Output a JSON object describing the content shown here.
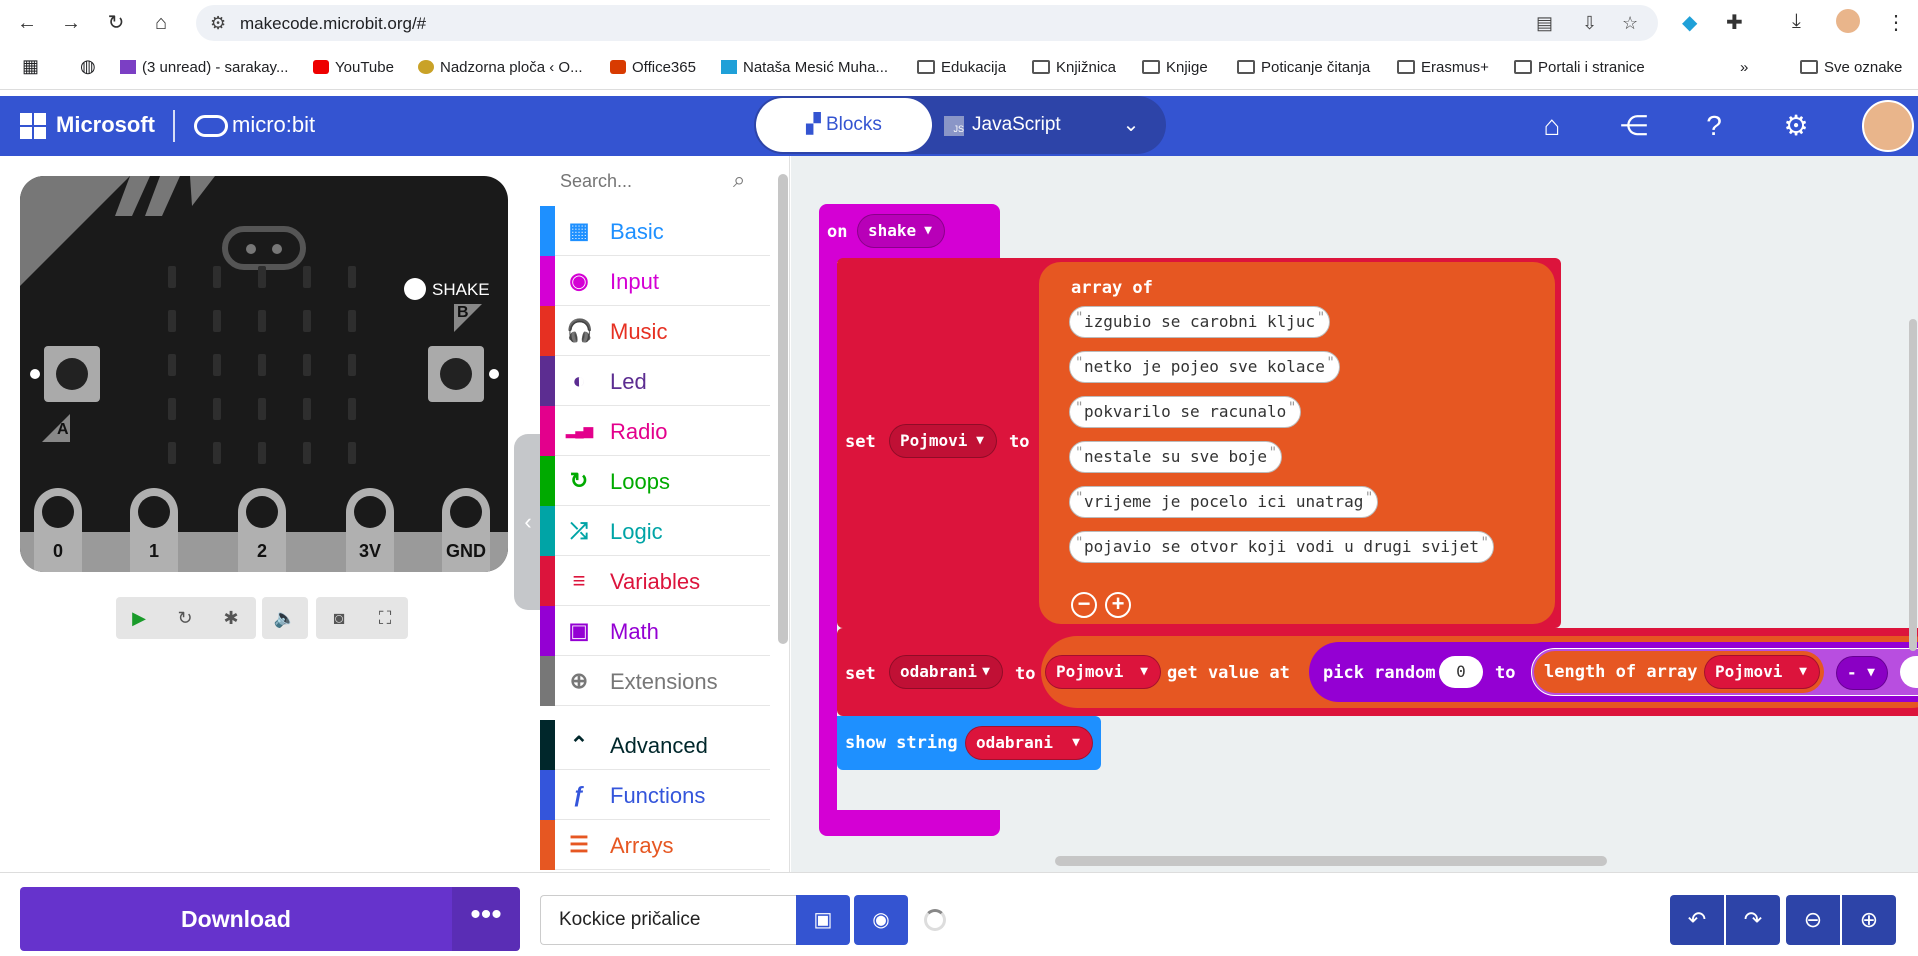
{
  "browser": {
    "url": "makecode.microbit.org/#",
    "bookmarks": [
      {
        "label": "(3 unread) - sarakay...",
        "icon": "mail-icon"
      },
      {
        "label": "YouTube",
        "icon": "youtube-icon"
      },
      {
        "label": "Nadzorna ploča ‹ O...",
        "icon": "site-icon"
      },
      {
        "label": "Office365",
        "icon": "office-icon"
      },
      {
        "label": "Nataša Mesić Muha...",
        "icon": "site-icon"
      },
      {
        "label": "Edukacija",
        "icon": "folder-icon"
      },
      {
        "label": "Knjižnica",
        "icon": "folder-icon"
      },
      {
        "label": "Knjige",
        "icon": "folder-icon"
      },
      {
        "label": "Poticanje čitanja",
        "icon": "folder-icon"
      },
      {
        "label": "Erasmus+",
        "icon": "folder-icon"
      },
      {
        "label": "Portali i stranice",
        "icon": "folder-icon"
      },
      {
        "label": "Sve oznake",
        "icon": "folder-icon"
      }
    ]
  },
  "header": {
    "brand": "Microsoft",
    "product": "micro:bit",
    "tabs": {
      "blocks": "Blocks",
      "javascript": "JavaScript"
    },
    "accent": "#3454d1"
  },
  "simulator": {
    "shake_label": "SHAKE",
    "button_a": "A",
    "button_b": "B",
    "pins": [
      "0",
      "1",
      "2",
      "3V",
      "GND"
    ]
  },
  "toolbox": {
    "search_placeholder": "Search...",
    "categories": [
      {
        "label": "Basic",
        "color": "#1e90ff",
        "icon": "grid-icon"
      },
      {
        "label": "Input",
        "color": "#d400d4",
        "icon": "target-icon"
      },
      {
        "label": "Music",
        "color": "#e63022",
        "icon": "headphones-icon"
      },
      {
        "label": "Led",
        "color": "#5c2d91",
        "icon": "toggle-icon"
      },
      {
        "label": "Radio",
        "color": "#e3008c",
        "icon": "signal-icon"
      },
      {
        "label": "Loops",
        "color": "#00aa00",
        "icon": "loop-icon"
      },
      {
        "label": "Logic",
        "color": "#00a4a6",
        "icon": "shuffle-icon"
      },
      {
        "label": "Variables",
        "color": "#dc143c",
        "icon": "list-icon"
      },
      {
        "label": "Math",
        "color": "#9400d3",
        "icon": "calculator-icon"
      },
      {
        "label": "Extensions",
        "color": "#777777",
        "icon": "plus-circle-icon"
      },
      {
        "label": "Advanced",
        "color": "#00272b",
        "icon": "chevron-up-icon"
      },
      {
        "label": "Functions",
        "color": "#3455db",
        "icon": "function-icon"
      },
      {
        "label": "Arrays",
        "color": "#e65722",
        "icon": "array-icon"
      }
    ]
  },
  "workspace": {
    "on_block": {
      "on": "on",
      "event": "shake"
    },
    "set1": {
      "set": "set",
      "var": "Pojmovi",
      "to": "to",
      "array_of": "array of"
    },
    "strings": [
      "izgubio se carobni kljuc",
      "netko je pojeo sve kolace",
      "pokvarilo se racunalo",
      "nestale su sve boje",
      "vrijeme je pocelo ici unatrag",
      "pojavio se otvor koji vodi u drugi svijet"
    ],
    "set2": {
      "set": "set",
      "var": "odabrani",
      "to": "to",
      "array_var": "Pojmovi",
      "get_value_at": "get value at",
      "pick_random": "pick random",
      "from": "0",
      "to2": "to",
      "length_of_array": "length of array",
      "length_var": "Pojmovi",
      "op": "-"
    },
    "show": {
      "label": "show string",
      "var": "odabrani"
    }
  },
  "bottom": {
    "download": "Download",
    "project_name": "Kockice pričalice"
  }
}
